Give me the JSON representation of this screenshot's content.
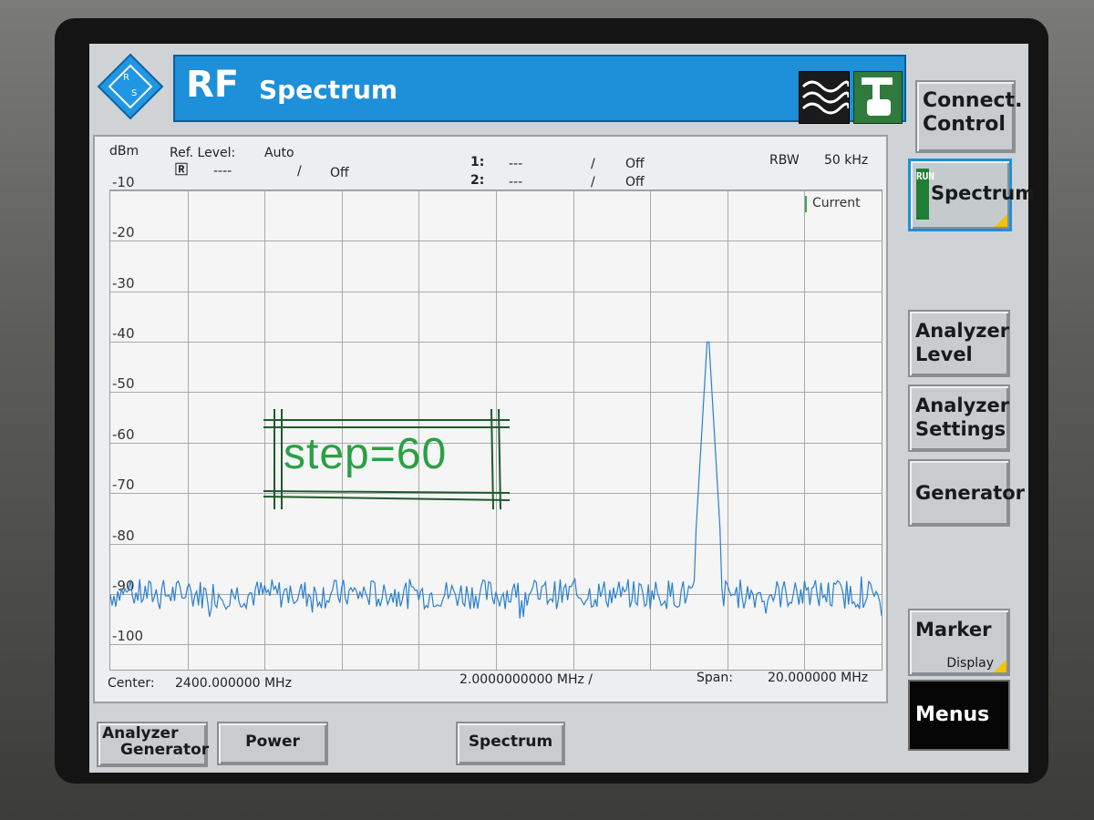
{
  "header": {
    "title_rf": "RF",
    "title_app": "Spectrum"
  },
  "connect_button": {
    "line1": "Connect.",
    "line2": "Control"
  },
  "plot": {
    "unit": "dBm",
    "ref_level_label": "Ref. Level:",
    "ref_level_value": "Auto",
    "r_marker_value": "----",
    "r_sep": "/",
    "r_state": "Off",
    "m1_value": "---",
    "m1_sep": "/",
    "m1_state": "Off",
    "m2_value": "---",
    "m2_sep": "/",
    "m2_state": "Off",
    "rbw_label": "RBW",
    "rbw_value": "50 kHz",
    "current_label": "Current",
    "center_label": "Center:",
    "center_value": "2400.000000  MHz",
    "div_value": "2.0000000000 MHz  /",
    "span_label": "Span:",
    "span_value": "20.000000  MHz",
    "y_ticks": [
      "-10",
      "-20",
      "-30",
      "-40",
      "-50",
      "-60",
      "-70",
      "-80",
      "-90",
      "-100"
    ]
  },
  "annotation": {
    "text": "step=60",
    "color": "#2aa044"
  },
  "side_buttons": {
    "run_tag": "RUN",
    "spectrum": "Spectrum",
    "analyzer_level_1": "Analyzer",
    "analyzer_level_2": "Level",
    "analyzer_settings_1": "Analyzer",
    "analyzer_settings_2": "Settings",
    "generator": "Generator",
    "marker": "Marker",
    "marker_sub": "Display",
    "menus": "Menus"
  },
  "bottom_buttons": {
    "analyzer_generator_1": "Analyzer",
    "analyzer_generator_2": "Generator",
    "power": "Power",
    "spectrum": "Spectrum"
  },
  "chart_data": {
    "type": "line",
    "ylabel": "dBm",
    "ylim": [
      -105,
      -10
    ],
    "xlim": [
      2390,
      2410
    ],
    "x_unit": "MHz",
    "noise_floor_dbm": -90,
    "peak": {
      "x": 2405.5,
      "y": -37
    },
    "grid": true
  },
  "colors": {
    "accent": "#1e8fd9",
    "trace": "#2a7fd0",
    "run_green": "#1f7e34"
  }
}
